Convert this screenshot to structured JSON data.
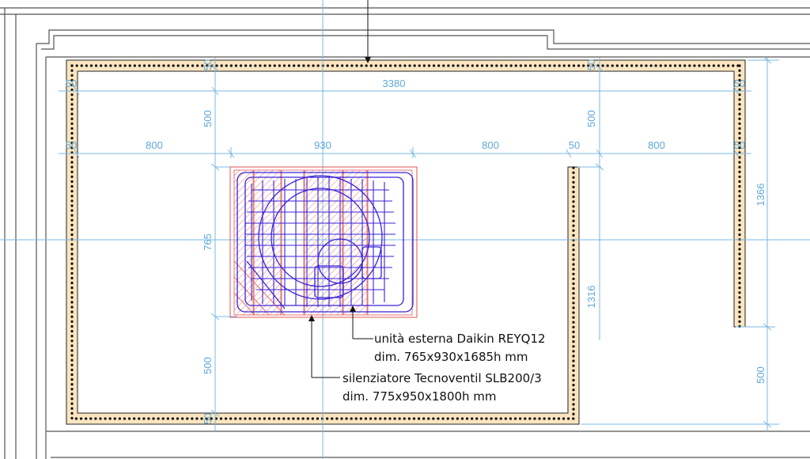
{
  "dimensions": {
    "overall_width": "3380",
    "left_gap": "800",
    "unit_width": "930",
    "right_gap": "800",
    "right_zone_width": "800",
    "thickness": "50",
    "top_clearance_left": "500",
    "top_clearance_right": "500",
    "unit_depth": "765",
    "bottom_clearance": "500",
    "wall_height": "1316",
    "right_segment_height": "1366",
    "right_bottom_gap": "500"
  },
  "annotations": {
    "unit_line1": "unità esterna Daikin REYQ12",
    "unit_line2": "dim. 765x930x1685h mm",
    "silencer_line1": "silenziatore Tecnoventil SLB200/3",
    "silencer_line2": "dim. 775x950x1800h mm"
  },
  "colors": {
    "wall_fill": "#fbe5c0",
    "dimension_lines": "#79b8e6",
    "unit_outline": "#3a22d8",
    "hatch": "#e05555"
  }
}
